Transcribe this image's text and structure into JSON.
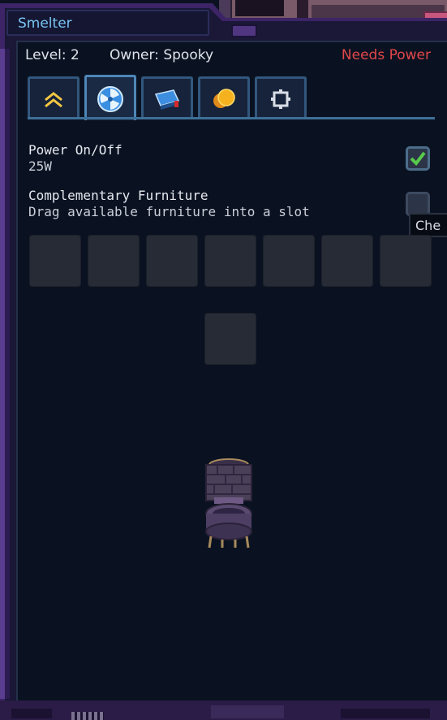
{
  "window": {
    "title": "Smelter"
  },
  "info": {
    "level": "Level: 2",
    "owner": "Owner: Spooky",
    "status": "Needs Power"
  },
  "tabs": [
    {
      "icon": "upgrade-chevron-icon",
      "active": false
    },
    {
      "icon": "fan-icon",
      "active": true
    },
    {
      "icon": "battery-icon",
      "active": false
    },
    {
      "icon": "coins-icon",
      "active": false
    },
    {
      "icon": "gear-icon",
      "active": false
    }
  ],
  "options": {
    "power": {
      "label": "Power On/Off",
      "sub": "25W",
      "checked": true
    },
    "furniture": {
      "label": "Complementary Furniture",
      "sub": "Drag available furniture into a slot",
      "checked": false
    }
  },
  "tooltip": {
    "text": "Che"
  },
  "slots": {
    "row_count": 7,
    "extra_count": 1
  },
  "colors": {
    "frame": "#3c2466",
    "title_text": "#79c4f2",
    "status_text": "#e0474a",
    "tab_border": "#32577d",
    "checkbox_check": "#57c94b",
    "background": "#0a1221"
  }
}
